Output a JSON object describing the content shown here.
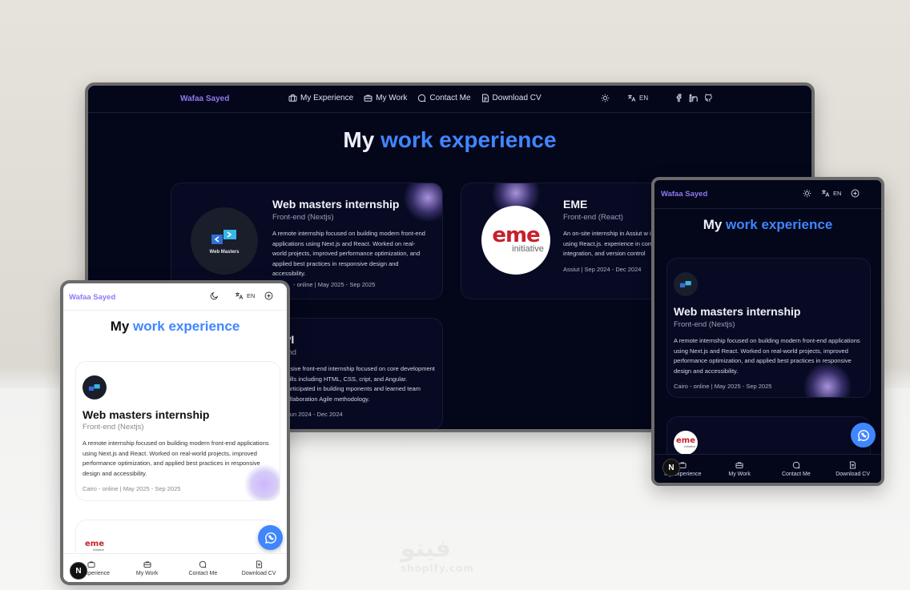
{
  "brand": "Wafaa Sayed",
  "nav": {
    "experience": "My Experience",
    "work": "My Work",
    "contact": "Contact Me",
    "cv": "Download CV"
  },
  "lang": "EN",
  "heading": {
    "lead": "My",
    "accent": "work experience"
  },
  "cards": [
    {
      "title": "Web masters internship",
      "role": "Front-end (Nextjs)",
      "desc": "A remote internship focused on building modern front-end applications using Next.js and React. Worked on real-world projects, improved performance optimization, and applied best practices in responsive design and accessibility.",
      "meta": "Cairo - online | May 2025 - Sep 2025",
      "logo_text": "Web Masters"
    },
    {
      "title": "EME",
      "role": "Front-end (React)",
      "desc": "An on-site internship in Assiut w interactive UIs using React.js. experience in component-base integration, and version control",
      "meta": "Assiut | Sep 2024 - Dec 2024",
      "logo_big": "eme",
      "logo_sub": "initiative"
    },
    {
      "title": "PI",
      "role": "end",
      "desc": "ensive front-end internship focused on core development skills including HTML, CSS, cript, and Angular. Participated in building mponents and learned team collaboration Agile methodology.",
      "meta": "| Jun 2024 - Dec 2024"
    }
  ],
  "laptop_card1_meta": "- online | May 2025 - Sep 2025",
  "badge": "N",
  "watermark": {
    "main": "فيتو",
    "sub": "shopify.com"
  },
  "colors": {
    "accent": "#3f86ff",
    "brand": "#8f7af2",
    "dark_bg": "#04061a",
    "whatsapp": "#3f86ff"
  },
  "icons": [
    "briefcase-icon",
    "bag-icon",
    "chat-icon",
    "document-icon",
    "sun-icon",
    "moon-icon",
    "translate-icon",
    "facebook-icon",
    "linkedin-icon",
    "github-icon",
    "whatsapp-icon",
    "plus-circle-icon"
  ]
}
